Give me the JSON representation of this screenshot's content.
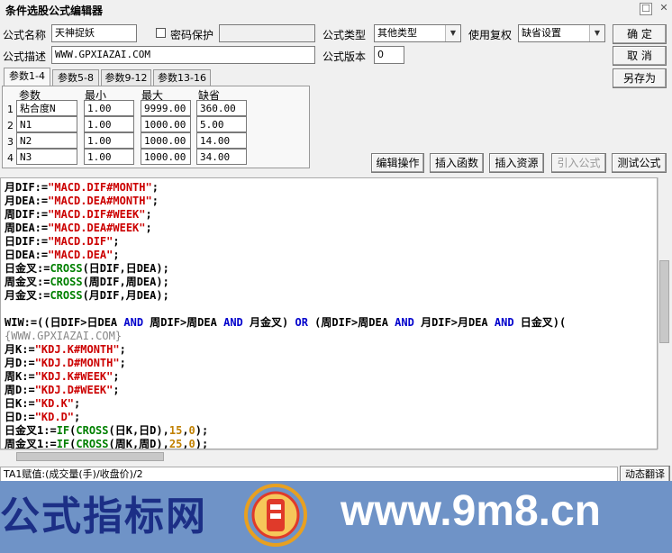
{
  "window": {
    "title": "条件选股公式编辑器",
    "restore_glyph": "☐",
    "close_glyph": "✕"
  },
  "form": {
    "name_label": "公式名称",
    "name_value": "天神捉妖",
    "password_label": "密码保护",
    "password_value": "",
    "type_label": "公式类型",
    "type_value": "其他类型",
    "reweight_label": "使用复权",
    "reweight_value": "缺省设置",
    "desc_label": "公式描述",
    "desc_value": "WWW.GPXIAZAI.COM",
    "version_label": "公式版本",
    "version_value": "0"
  },
  "buttons": {
    "ok": "确  定",
    "cancel": "取  消",
    "save_as": "另存为",
    "edit_ops": "编辑操作",
    "insert_func": "插入函数",
    "insert_res": "插入资源",
    "import_formula": "引入公式",
    "test_formula": "测试公式",
    "dynamic_translate": "动态翻译"
  },
  "tabs": [
    "参数1-4",
    "参数5-8",
    "参数9-12",
    "参数13-16"
  ],
  "params": {
    "headers": [
      "参数",
      "最小",
      "最大",
      "缺省"
    ],
    "rows": [
      {
        "idx": "1",
        "name": "粘合度N",
        "min": "1.00",
        "max": "9999.00",
        "default": "360.00"
      },
      {
        "idx": "2",
        "name": "N1",
        "min": "1.00",
        "max": "1000.00",
        "default": "5.00"
      },
      {
        "idx": "3",
        "name": "N2",
        "min": "1.00",
        "max": "1000.00",
        "default": "14.00"
      },
      {
        "idx": "4",
        "name": "N3",
        "min": "1.00",
        "max": "1000.00",
        "default": "34.00"
      }
    ]
  },
  "status": "TA1赋值:(成交量(手)/收盘价)/2",
  "watermark": {
    "left": "公式指标网",
    "right": "www.9m8.cn"
  },
  "colors": {
    "keyword": "#0000cc",
    "string": "#cc0000",
    "function": "#008000",
    "number": "#c08000"
  },
  "code": [
    [
      [
        "t",
        "月DIF:="
      ],
      [
        "s",
        "\"MACD.DIF#MONTH\""
      ],
      [
        "t",
        ";"
      ]
    ],
    [
      [
        "t",
        "月DEA:="
      ],
      [
        "s",
        "\"MACD.DEA#MONTH\""
      ],
      [
        "t",
        ";"
      ]
    ],
    [
      [
        "t",
        "周DIF:="
      ],
      [
        "s",
        "\"MACD.DIF#WEEK\""
      ],
      [
        "t",
        ";"
      ]
    ],
    [
      [
        "t",
        "周DEA:="
      ],
      [
        "s",
        "\"MACD.DEA#WEEK\""
      ],
      [
        "t",
        ";"
      ]
    ],
    [
      [
        "t",
        "日DIF:="
      ],
      [
        "s",
        "\"MACD.DIF\""
      ],
      [
        "t",
        ";"
      ]
    ],
    [
      [
        "t",
        "日DEA:="
      ],
      [
        "s",
        "\"MACD.DEA\""
      ],
      [
        "t",
        ";"
      ]
    ],
    [
      [
        "t",
        "日金叉:="
      ],
      [
        "f",
        "CROSS"
      ],
      [
        "t",
        "(日DIF,日DEA);"
      ]
    ],
    [
      [
        "t",
        "周金叉:="
      ],
      [
        "f",
        "CROSS"
      ],
      [
        "t",
        "(周DIF,周DEA);"
      ]
    ],
    [
      [
        "t",
        "月金叉:="
      ],
      [
        "f",
        "CROSS"
      ],
      [
        "t",
        "(月DIF,月DEA);"
      ]
    ],
    [
      [
        "t",
        ""
      ]
    ],
    [
      [
        "t",
        "WIW:=((日DIF>日DEA "
      ],
      [
        "k",
        "AND"
      ],
      [
        "t",
        " 周DIF>周DEA "
      ],
      [
        "k",
        "AND"
      ],
      [
        "t",
        " 月金叉) "
      ],
      [
        "k",
        "OR"
      ],
      [
        "t",
        " (周DIF>周DEA "
      ],
      [
        "k",
        "AND"
      ],
      [
        "t",
        " 月DIF>月DEA "
      ],
      [
        "k",
        "AND"
      ],
      [
        "t",
        " 日金叉)("
      ]
    ],
    [
      [
        "g",
        "{WWW.GPXIAZAI.COM}"
      ]
    ],
    [
      [
        "t",
        "月K:="
      ],
      [
        "s",
        "\"KDJ.K#MONTH\""
      ],
      [
        "t",
        ";"
      ]
    ],
    [
      [
        "t",
        "月D:="
      ],
      [
        "s",
        "\"KDJ.D#MONTH\""
      ],
      [
        "t",
        ";"
      ]
    ],
    [
      [
        "t",
        "周K:="
      ],
      [
        "s",
        "\"KDJ.K#WEEK\""
      ],
      [
        "t",
        ";"
      ]
    ],
    [
      [
        "t",
        "周D:="
      ],
      [
        "s",
        "\"KDJ.D#WEEK\""
      ],
      [
        "t",
        ";"
      ]
    ],
    [
      [
        "t",
        "日K:="
      ],
      [
        "s",
        "\"KD.K\""
      ],
      [
        "t",
        ";"
      ]
    ],
    [
      [
        "t",
        "日D:="
      ],
      [
        "s",
        "\"KD.D\""
      ],
      [
        "t",
        ";"
      ]
    ],
    [
      [
        "t",
        "日金叉1:="
      ],
      [
        "f",
        "IF"
      ],
      [
        "t",
        "("
      ],
      [
        "f",
        "CROSS"
      ],
      [
        "t",
        "(日K,日D),"
      ],
      [
        "n",
        "15"
      ],
      [
        "t",
        ","
      ],
      [
        "n",
        "0"
      ],
      [
        "t",
        ");"
      ]
    ],
    [
      [
        "t",
        "周金叉1:="
      ],
      [
        "f",
        "IF"
      ],
      [
        "t",
        "("
      ],
      [
        "f",
        "CROSS"
      ],
      [
        "t",
        "(周K,周D),"
      ],
      [
        "n",
        "25"
      ],
      [
        "t",
        ","
      ],
      [
        "n",
        "0"
      ],
      [
        "t",
        ");"
      ]
    ]
  ]
}
